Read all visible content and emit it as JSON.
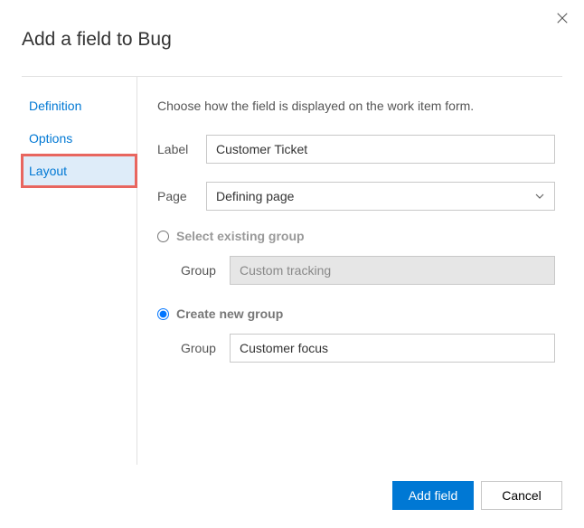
{
  "dialog": {
    "title": "Add a field to Bug"
  },
  "sidebar": {
    "items": [
      {
        "label": "Definition"
      },
      {
        "label": "Options"
      },
      {
        "label": "Layout"
      }
    ]
  },
  "content": {
    "description": "Choose how the field is displayed on the work item form.",
    "labelField": {
      "label": "Label",
      "value": "Customer Ticket"
    },
    "pageField": {
      "label": "Page",
      "value": "Defining page"
    },
    "existingGroup": {
      "radioLabel": "Select existing group",
      "groupLabel": "Group",
      "value": "Custom tracking"
    },
    "newGroup": {
      "radioLabel": "Create new group",
      "groupLabel": "Group",
      "value": "Customer focus"
    }
  },
  "footer": {
    "primary": "Add field",
    "cancel": "Cancel"
  }
}
